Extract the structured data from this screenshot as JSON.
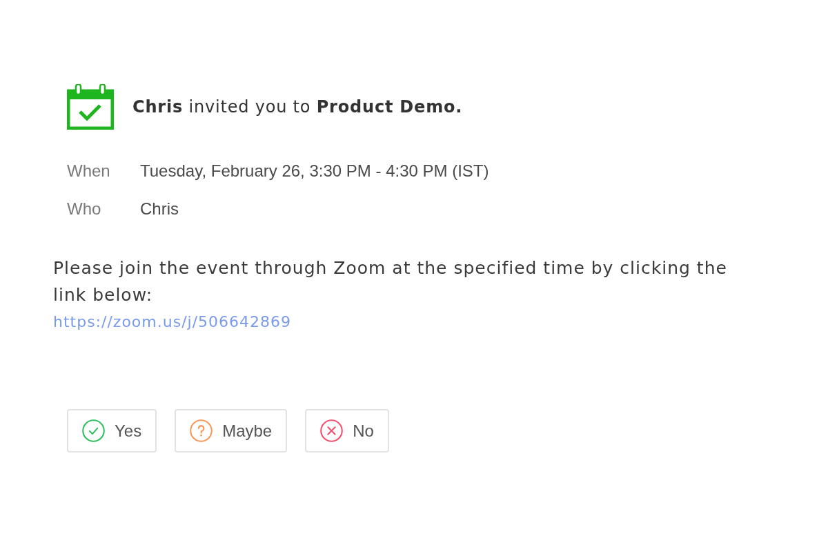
{
  "invitation": {
    "message": "**Chris** invited you to **Product Demo.**"
  },
  "details": [
    {
      "label": "When",
      "value": "Tuesday, February 26, 3:30 PM - 4:30 PM (IST)"
    },
    {
      "label": "Who",
      "value": "Chris"
    }
  ],
  "body": {
    "text": "Please join the event through Zoom at the specified time by clicking the link below:",
    "link": "https://zoom.us/j/506642869"
  },
  "responses": [
    {
      "kind": "yes",
      "label": "Yes",
      "color": "#2fbf5f"
    },
    {
      "kind": "maybe",
      "label": "Maybe",
      "color": "#f4995a"
    },
    {
      "kind": "no",
      "label": "No",
      "color": "#f2506e"
    }
  ]
}
